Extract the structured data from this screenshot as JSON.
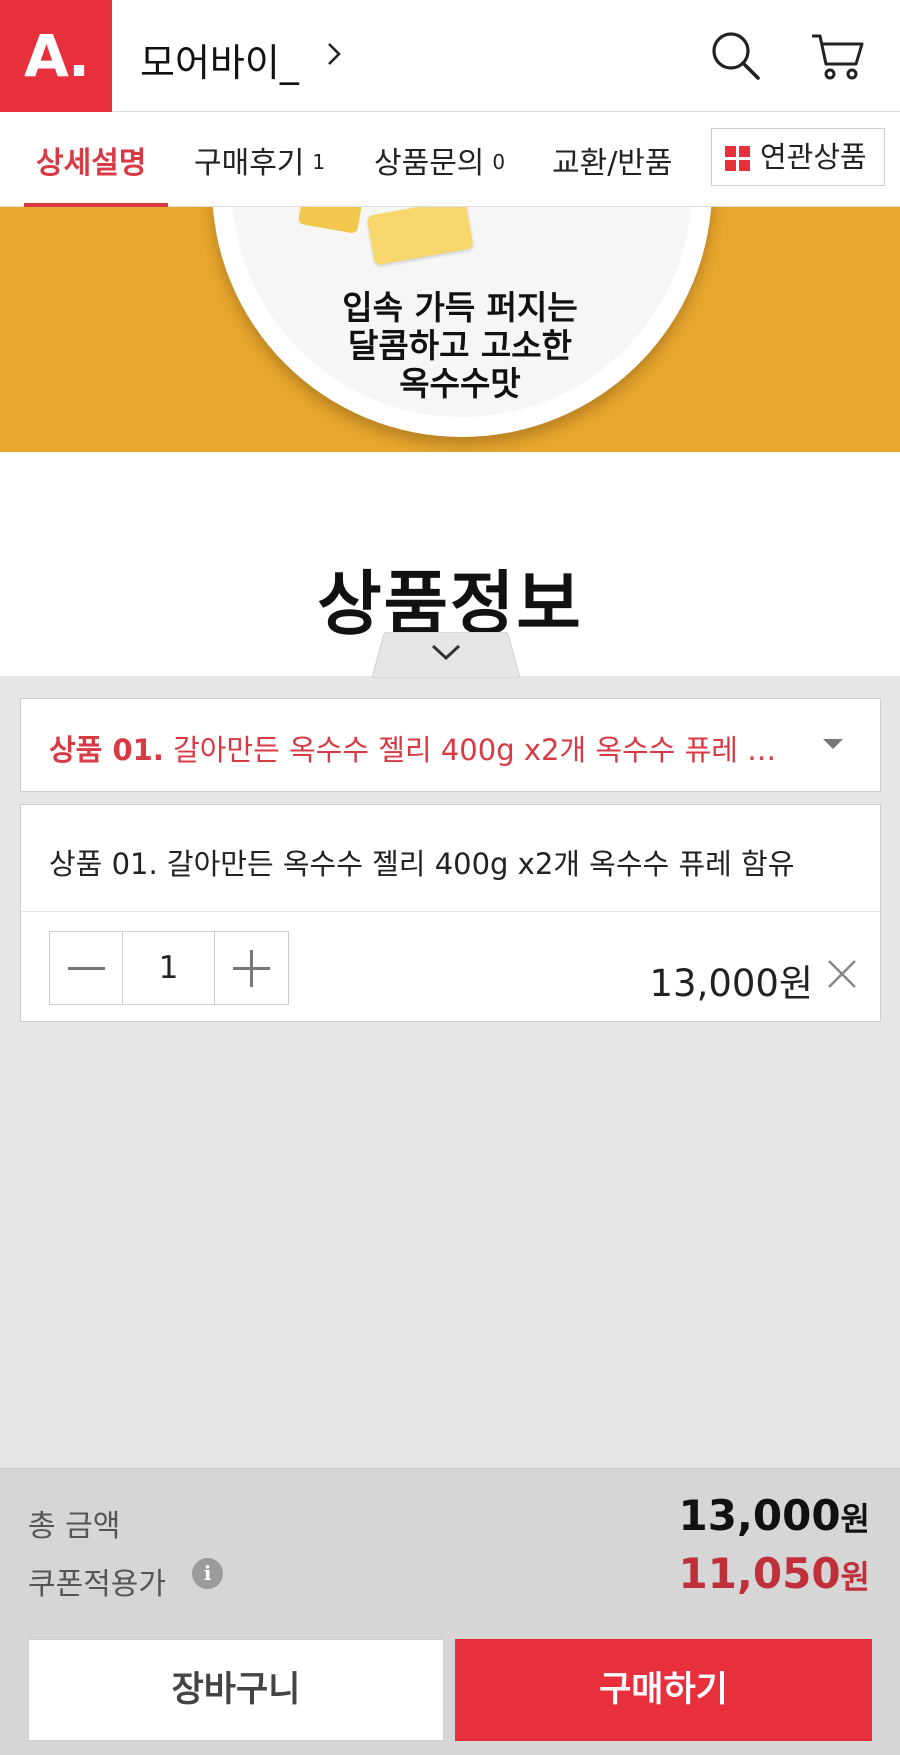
{
  "header": {
    "logo_text": "A.",
    "store_name": "모어바이_",
    "icons": [
      "chevron-right-icon",
      "search-icon",
      "cart-icon"
    ]
  },
  "tabs": [
    {
      "label": "상세설명",
      "count": "",
      "active": true
    },
    {
      "label": "구매후기",
      "count": "1",
      "active": false
    },
    {
      "label": "상품문의",
      "count": "0",
      "active": false
    },
    {
      "label": "교환/반품",
      "count": "",
      "active": false
    }
  ],
  "related_button": {
    "label": "연관상품",
    "icon": "grid-icon"
  },
  "banner": {
    "line1": "입속 가득 퍼지는",
    "line2": "달콤하고 고소한",
    "line3": "옥수수맛"
  },
  "section_title": "상품정보",
  "option_select": {
    "prefix": "상품 01.",
    "text": "갈아만든 옥수수 젤리 400g x2개 옥수수 퓨레 함유"
  },
  "selected_item": {
    "name": "상품 01. 갈아만든 옥수수 젤리 400g x2개 옥수수 퓨레 함유",
    "quantity": "1",
    "price": "13,000원"
  },
  "totals": {
    "total_label": "총 금액",
    "total_amount": "13,000",
    "coupon_label": "쿠폰적용가",
    "coupon_amount": "11,050",
    "currency": "원",
    "info_icon": "i"
  },
  "actions": {
    "cart_label": "장바구니",
    "buy_label": "구매하기"
  },
  "colors": {
    "brand": "#e8303d",
    "active_tab": "#d83a44",
    "banner_bg": "#e9a62d",
    "coupon_price": "#c0303a"
  }
}
